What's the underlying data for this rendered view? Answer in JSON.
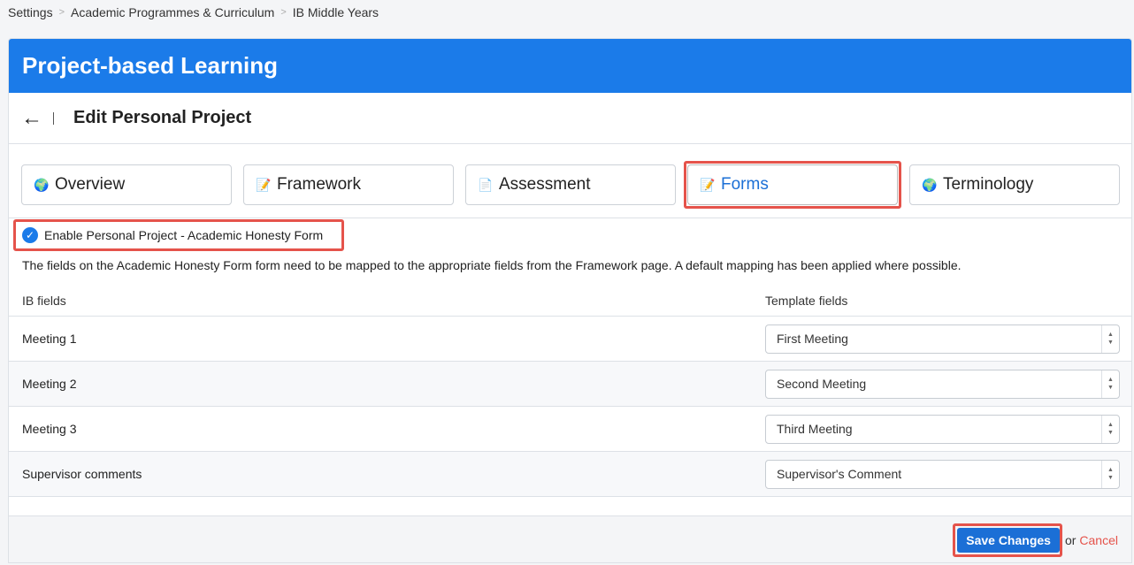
{
  "breadcrumb": [
    "Settings",
    "Academic Programmes & Curriculum",
    "IB Middle Years"
  ],
  "banner_title": "Project-based Learning",
  "page_title": "Edit Personal Project",
  "tabs": [
    {
      "label": "Overview",
      "icon": "globe-icon",
      "glyph": "🌍"
    },
    {
      "label": "Framework",
      "icon": "notepad-icon",
      "glyph": "📝"
    },
    {
      "label": "Assessment",
      "icon": "document-icon",
      "glyph": "📄"
    },
    {
      "label": "Forms",
      "icon": "memo-icon",
      "glyph": "📝"
    },
    {
      "label": "Terminology",
      "icon": "globe-icon",
      "glyph": "🌍"
    }
  ],
  "active_tab": "Forms",
  "enable_label": "Enable Personal Project - Academic Honesty Form",
  "enable_checked": true,
  "description": "The fields on the Academic Honesty Form form need to be mapped to the appropriate fields from the Framework page. A default mapping has been applied where possible.",
  "table": {
    "headers": [
      "IB fields",
      "Template fields"
    ],
    "rows": [
      {
        "field": "Meeting 1",
        "value": "First Meeting"
      },
      {
        "field": "Meeting 2",
        "value": "Second Meeting"
      },
      {
        "field": "Meeting 3",
        "value": "Third Meeting"
      },
      {
        "field": "Supervisor comments",
        "value": "Supervisor's Comment"
      }
    ]
  },
  "footer": {
    "save_label": "Save Changes",
    "or_text": "or",
    "cancel_label": "Cancel"
  },
  "colors": {
    "accent": "#1b7be9",
    "highlight": "#e5534b",
    "cancel": "#e5534b"
  }
}
